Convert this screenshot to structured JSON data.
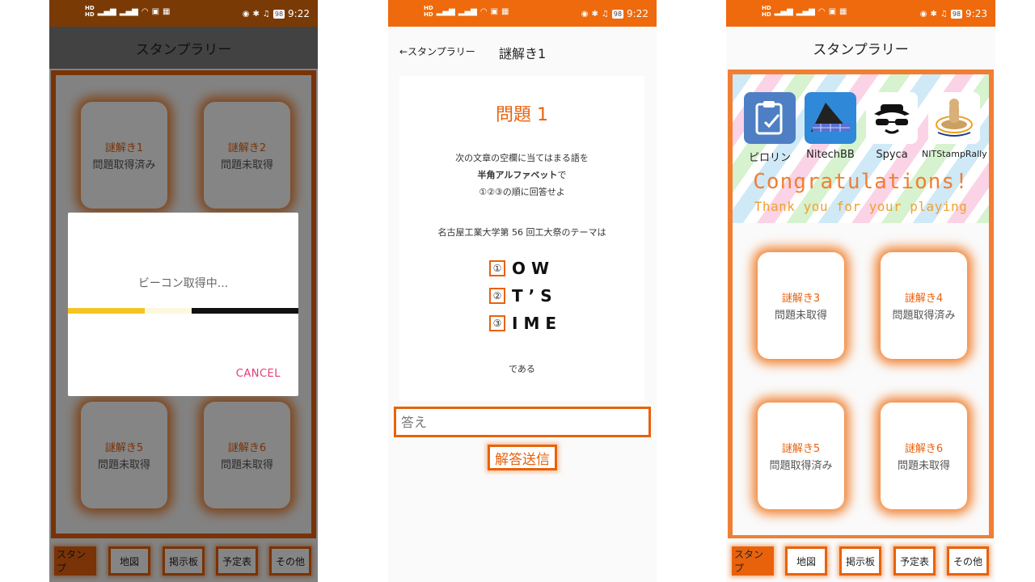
{
  "screens": {
    "stamp_loading": {
      "status": {
        "battery": "98",
        "time": "9:22"
      },
      "title": "スタンプラリー",
      "cards": [
        {
          "title": "謎解き1",
          "status": "問題取得済み"
        },
        {
          "title": "謎解き2",
          "status": "問題未取得"
        },
        {
          "title": "謎解き5",
          "status": "問題未取得"
        },
        {
          "title": "謎解き6",
          "status": "問題未取得"
        }
      ],
      "dialog": {
        "message": "ビーコン取得中...",
        "cancel_label": "CANCEL"
      },
      "nav": [
        "スタンプ",
        "地図",
        "掲示板",
        "予定表",
        "その他"
      ]
    },
    "quiz": {
      "status": {
        "battery": "98",
        "time": "9:22"
      },
      "back_label": "←スタンプラリー",
      "title": "謎解き1",
      "heading": "問題 1",
      "line1": "次の文章の空欄に当てはまる語を",
      "line2_bold": "半角アルファベット",
      "line2_suffix": "で",
      "line3": "①②③の順に回答せよ",
      "question": "名古屋工業大学第 56 回工大祭のテーマは",
      "answers": [
        {
          "num": "①",
          "word": "OW"
        },
        {
          "num": "②",
          "word": "T’S"
        },
        {
          "num": "③",
          "word": "IME"
        }
      ],
      "ending": "である",
      "input_placeholder": "答え",
      "submit_label": "解答送信"
    },
    "stamp_done": {
      "status": {
        "battery": "98",
        "time": "9:23"
      },
      "title": "スタンプラリー",
      "banner": {
        "apps": [
          {
            "name": "ピロリン",
            "icon": "clipboard-pen-icon",
            "color": "#4e7fc4"
          },
          {
            "name": "NitechBB",
            "icon": "solar-panel-icon",
            "color": "#2f89d8"
          },
          {
            "name": "Spyca",
            "icon": "spy-hat-icon",
            "color": "#ffffff"
          },
          {
            "name": "NITStampRally",
            "icon": "stamp-icon",
            "color": "#ffffff"
          }
        ],
        "congrats": "Congratulations!",
        "thanks": "Thank you for your playing"
      },
      "cards": [
        {
          "title": "謎解き3",
          "status": "問題未取得"
        },
        {
          "title": "謎解き4",
          "status": "問題取得済み"
        },
        {
          "title": "謎解き5",
          "status": "問題取得済み"
        },
        {
          "title": "謎解き6",
          "status": "問題未取得"
        }
      ],
      "nav": [
        "スタンプ",
        "地図",
        "掲示板",
        "予定表",
        "その他"
      ]
    }
  },
  "colors": {
    "accent": "#e8620c",
    "glow": "#f07d2a",
    "dialog_cancel": "#e23c7a",
    "progress_yellow": "#f4c422"
  }
}
